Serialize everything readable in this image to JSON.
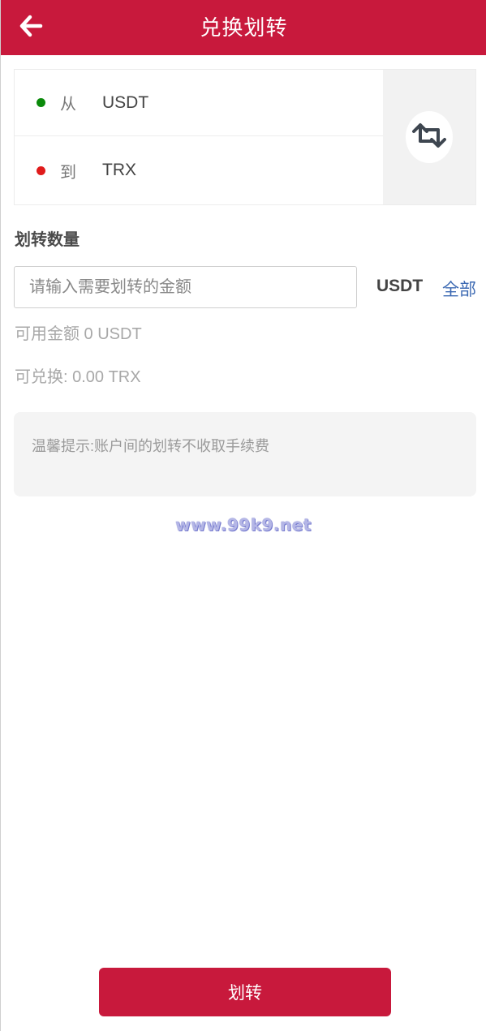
{
  "header": {
    "title": "兑换划转",
    "back_icon": "arrow-left-icon"
  },
  "swap": {
    "from": {
      "direction": "从",
      "coin": "USDT",
      "dot_color": "#0a8a0a"
    },
    "to": {
      "direction": "到",
      "coin": "TRX",
      "dot_color": "#e01b1b"
    },
    "swap_icon": "swap-arrows-icon"
  },
  "amount": {
    "section_title": "划转数量",
    "placeholder": "请输入需要划转的金额",
    "value": "",
    "unit": "USDT",
    "all_label": "全部"
  },
  "info": {
    "available": "可用金额 0 USDT",
    "convertible": "可兑换: 0.00 TRX"
  },
  "tip": {
    "text": "温馨提示:账户间的划转不收取手续费"
  },
  "watermark": "www.99k9.net",
  "submit": {
    "label": "划转"
  },
  "colors": {
    "brand": "#c8193c",
    "link": "#3d6ab3"
  }
}
